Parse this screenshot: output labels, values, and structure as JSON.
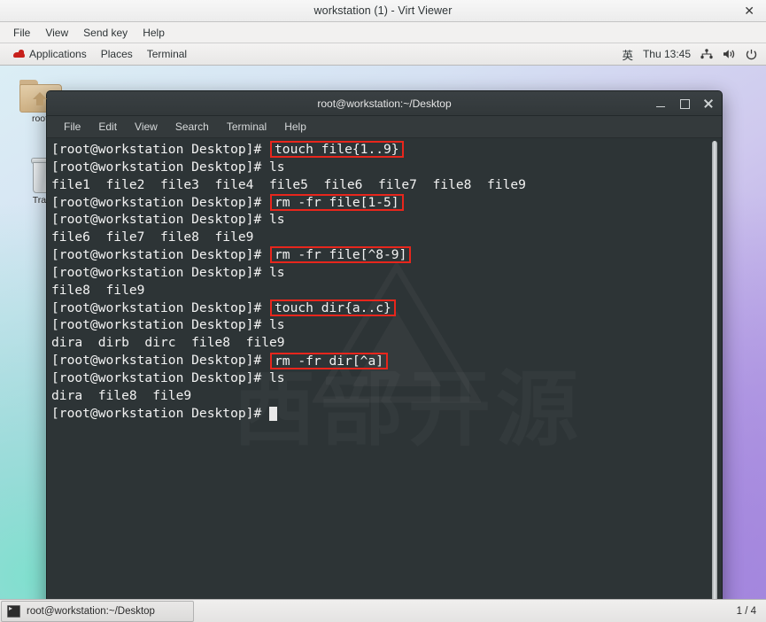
{
  "viewer": {
    "title": "workstation (1) - Virt Viewer",
    "close_label": "✕",
    "menu": [
      "File",
      "View",
      "Send key",
      "Help"
    ]
  },
  "gnome_panel": {
    "items": [
      "Applications",
      "Places",
      "Terminal"
    ],
    "tray": {
      "input_method": "英",
      "clock": "Thu 13:45",
      "network_icon": "network-icon",
      "volume_icon": "volume-icon",
      "power_icon": "power-icon"
    }
  },
  "desktop": {
    "icons": [
      {
        "label": "root",
        "type": "home-folder"
      },
      {
        "label": "Trash",
        "type": "trash"
      }
    ]
  },
  "terminal": {
    "title": "root@workstation:~/Desktop",
    "menu": [
      "File",
      "Edit",
      "View",
      "Search",
      "Terminal",
      "Help"
    ],
    "watermark": "西部开源",
    "prompt": "[root@workstation Desktop]# ",
    "highlight_color": "#e8261c",
    "background_color": "#2d3436",
    "foreground_color": "#f2f2f2",
    "lines": [
      {
        "prompt": "[root@workstation Desktop]# ",
        "cmd": "touch file{1..9}",
        "highlight": true
      },
      {
        "prompt": "[root@workstation Desktop]# ",
        "cmd": "ls",
        "highlight": false
      },
      {
        "output": "file1  file2  file3  file4  file5  file6  file7  file8  file9"
      },
      {
        "prompt": "[root@workstation Desktop]# ",
        "cmd": "rm -fr file[1-5]",
        "highlight": true
      },
      {
        "prompt": "[root@workstation Desktop]# ",
        "cmd": "ls",
        "highlight": false
      },
      {
        "output": "file6  file7  file8  file9"
      },
      {
        "prompt": "[root@workstation Desktop]# ",
        "cmd": "rm -fr file[^8-9]",
        "highlight": true
      },
      {
        "prompt": "[root@workstation Desktop]# ",
        "cmd": "ls",
        "highlight": false
      },
      {
        "output": "file8  file9"
      },
      {
        "prompt": "[root@workstation Desktop]# ",
        "cmd": "touch dir{a..c}",
        "highlight": true
      },
      {
        "prompt": "[root@workstation Desktop]# ",
        "cmd": "ls",
        "highlight": false
      },
      {
        "output": "dira  dirb  dirc  file8  file9"
      },
      {
        "prompt": "[root@workstation Desktop]# ",
        "cmd": "rm -fr dir[^a]",
        "highlight": true
      },
      {
        "prompt": "[root@workstation Desktop]# ",
        "cmd": "ls",
        "highlight": false
      },
      {
        "output": "dira  file8  file9"
      },
      {
        "prompt": "[root@workstation Desktop]# ",
        "cmd": "",
        "highlight": false,
        "cursor": true
      }
    ]
  },
  "taskbar": {
    "window_label": "root@workstation:~/Desktop",
    "workspace": "1 / 4"
  }
}
